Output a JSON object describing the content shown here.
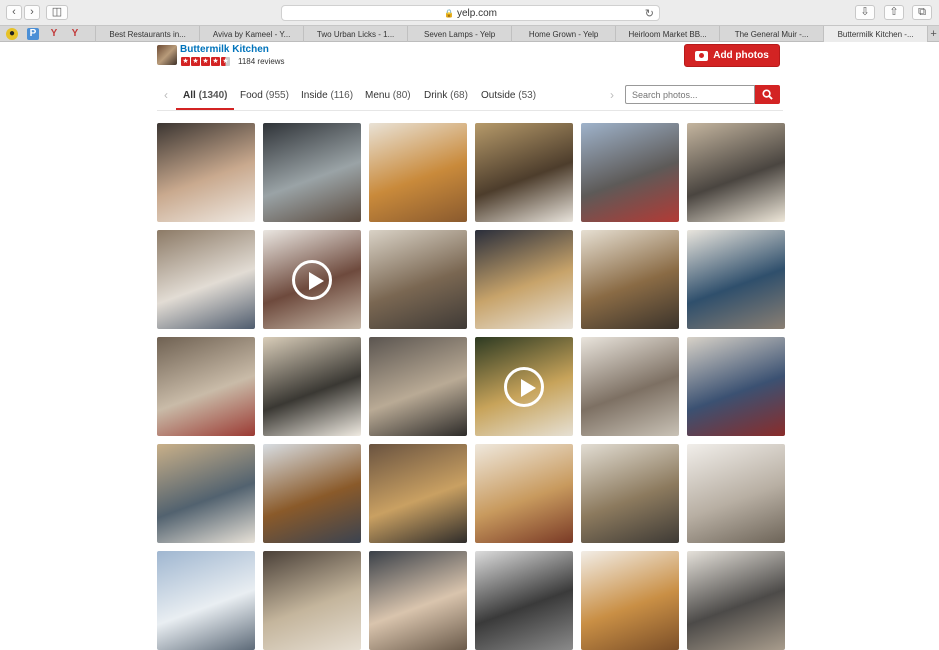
{
  "browser": {
    "url": "yelp.com",
    "favorites": [
      "bee-bookmark",
      "P",
      "Y",
      "Y"
    ],
    "tabs": [
      {
        "title": "Best Restaurants in..."
      },
      {
        "title": "Aviva by Kameel - Y..."
      },
      {
        "title": "Two Urban Licks - 1..."
      },
      {
        "title": "Seven Lamps - Yelp"
      },
      {
        "title": "Home Grown - Yelp"
      },
      {
        "title": "Heirloom Market BB..."
      },
      {
        "title": "The General Muir -..."
      },
      {
        "title": "Buttermilk Kitchen -..."
      }
    ],
    "active_tab": 7,
    "new_tab_label": "+"
  },
  "business": {
    "name": "Buttermilk Kitchen",
    "rating": 4.5,
    "reviews": "1184 reviews"
  },
  "add_photos_label": "Add photos",
  "filters": [
    {
      "label": "All",
      "count": "(1340)",
      "active": true
    },
    {
      "label": "Food",
      "count": "(955)"
    },
    {
      "label": "Inside",
      "count": "(116)"
    },
    {
      "label": "Menu",
      "count": "(80)"
    },
    {
      "label": "Drink",
      "count": "(68)"
    },
    {
      "label": "Outside",
      "count": "(53)"
    }
  ],
  "search": {
    "placeholder": "Search photos..."
  },
  "photos": [
    {
      "subject": "diner with plate",
      "colors": [
        "#3b3531",
        "#c9a98e",
        "#efe9e2"
      ]
    },
    {
      "subject": "dining room",
      "colors": [
        "#2f3338",
        "#9aa3a6",
        "#5a4a3e"
      ]
    },
    {
      "subject": "fried chicken biscuit",
      "colors": [
        "#e9e2d6",
        "#c98a3b",
        "#8a5a2e"
      ]
    },
    {
      "subject": "coffee and pastries",
      "colors": [
        "#b69a6a",
        "#4d3d2c",
        "#e9e4dc"
      ]
    },
    {
      "subject": "storefront parking lot",
      "colors": [
        "#9fb3cb",
        "#5d5a58",
        "#b33a35"
      ]
    },
    {
      "subject": "interior with fireplace",
      "colors": [
        "#c4b59f",
        "#4a4540",
        "#efe8da"
      ]
    },
    {
      "subject": "crowded dining room",
      "colors": [
        "#8c7a66",
        "#e2dcd4",
        "#4f5c6e"
      ]
    },
    {
      "subject": "plate video",
      "colors": [
        "#eae6e1",
        "#6e4a3d",
        "#c7b9a9"
      ],
      "video": true
    },
    {
      "subject": "dining room tables",
      "colors": [
        "#d9d2c6",
        "#7a6752",
        "#3f3a36"
      ]
    },
    {
      "subject": "breakfast table",
      "colors": [
        "#2a2e3b",
        "#c7a36a",
        "#e9e3da"
      ]
    },
    {
      "subject": "kitchen pass",
      "colors": [
        "#e6dfd2",
        "#8a6b45",
        "#3b332b"
      ]
    },
    {
      "subject": "dining room blue wall",
      "colors": [
        "#e9e5dd",
        "#2f4f6c",
        "#8a7f73"
      ]
    },
    {
      "subject": "counter seating",
      "colors": [
        "#6f6152",
        "#c9bba8",
        "#9b3a33"
      ]
    },
    {
      "subject": "busy lunch",
      "colors": [
        "#d9cdb9",
        "#3a3833",
        "#f0ebe2"
      ]
    },
    {
      "subject": "queue at counter",
      "colors": [
        "#5b5550",
        "#b9aa95",
        "#2d2b29"
      ]
    },
    {
      "subject": "bowl video",
      "colors": [
        "#2d3a22",
        "#c7a35a",
        "#e6e0d4"
      ],
      "video": true
    },
    {
      "subject": "entrance area",
      "colors": [
        "#e9e4dc",
        "#7d7063",
        "#c9c2b6"
      ]
    },
    {
      "subject": "dining room window",
      "colors": [
        "#d8d2c8",
        "#3b5172",
        "#8a2c2a"
      ]
    },
    {
      "subject": "seated guests",
      "colors": [
        "#c9b089",
        "#52626f",
        "#e8e2d8"
      ]
    },
    {
      "subject": "plated dish",
      "colors": [
        "#d8dde2",
        "#8a5a2a",
        "#3b4350"
      ]
    },
    {
      "subject": "takeout box",
      "colors": [
        "#6a5340",
        "#c9a062",
        "#2f2c2a"
      ]
    },
    {
      "subject": "biscuit sandwich",
      "colors": [
        "#efe8dd",
        "#c89a5e",
        "#7a3a26"
      ]
    },
    {
      "subject": "order counter",
      "colors": [
        "#e2ddd3",
        "#8c7a5e",
        "#3e3a35"
      ]
    },
    {
      "subject": "bright interior",
      "colors": [
        "#f1eeea",
        "#b8afa3",
        "#6d6458"
      ]
    },
    {
      "subject": "sky exterior",
      "colors": [
        "#9fb6d0",
        "#e9eef2",
        "#5d6a78"
      ]
    },
    {
      "subject": "interior lights",
      "colors": [
        "#4a4038",
        "#c4b59c",
        "#e6ded2"
      ]
    },
    {
      "subject": "guest portrait",
      "colors": [
        "#3a4048",
        "#d9c4ad",
        "#6a5a4a"
      ]
    },
    {
      "subject": "storefront sign",
      "colors": [
        "#dcdcdc",
        "#3a3a3a",
        "#8a8a8a"
      ]
    },
    {
      "subject": "biscuit closeup",
      "colors": [
        "#f2ede6",
        "#c98f45",
        "#7c4f28"
      ]
    },
    {
      "subject": "interior wall",
      "colors": [
        "#e5e1da",
        "#4c4a48",
        "#a89c8c"
      ]
    }
  ],
  "colors": {
    "brand_red": "#d32323",
    "link_blue": "#0073bb"
  }
}
